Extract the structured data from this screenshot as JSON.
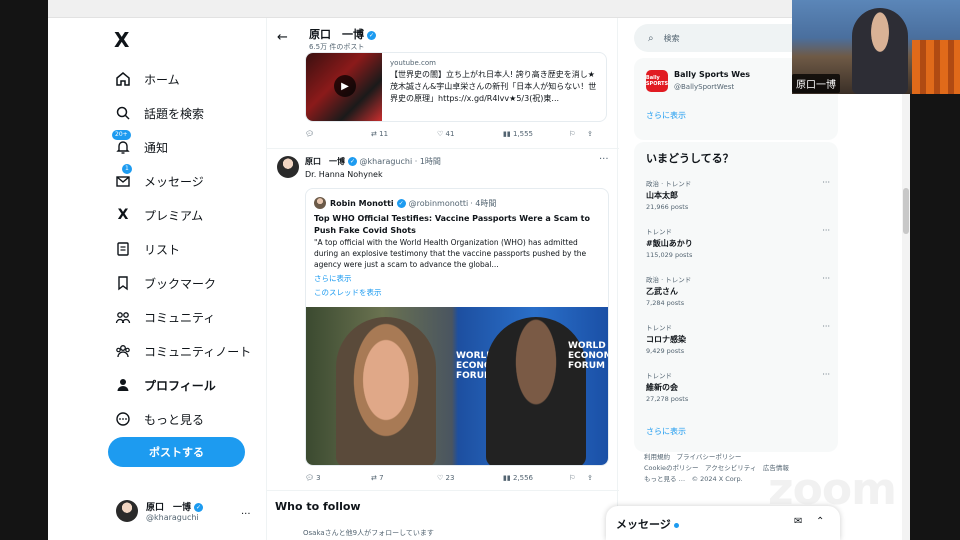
{
  "sidebar": {
    "logo": "X",
    "items": [
      {
        "label": "ホーム",
        "icon": "home-icon"
      },
      {
        "label": "話題を検索",
        "icon": "search-icon"
      },
      {
        "label": "通知",
        "icon": "bell-icon",
        "badge": "20+"
      },
      {
        "label": "メッセージ",
        "icon": "mail-icon",
        "badge": "1"
      },
      {
        "label": "プレミアム",
        "icon": "x-premium-icon"
      },
      {
        "label": "リスト",
        "icon": "list-icon"
      },
      {
        "label": "ブックマーク",
        "icon": "bookmark-icon"
      },
      {
        "label": "コミュニティ",
        "icon": "community-icon"
      },
      {
        "label": "コミュニティノート",
        "icon": "community-notes-icon"
      },
      {
        "label": "プロフィール",
        "icon": "profile-icon"
      },
      {
        "label": "もっと見る",
        "icon": "more-circle-icon"
      }
    ],
    "post_button": "ポストする",
    "account": {
      "name": "原口　一博",
      "handle": "@kharaguchi",
      "more": "..."
    }
  },
  "header": {
    "back": "←",
    "name": "原口　一博",
    "count": "6.5万 件のポスト"
  },
  "link_card": {
    "domain": "youtube.com",
    "title": "【世界史の闇】立ち上がれ日本人! 誇り高き歴史を消し★茂木誠さん&宇山卓栄さんの新刊「日本人が知らない！世界史の原理」https://x.gd/R4lvv★5/3(祝)東..."
  },
  "first_actions": {
    "replies": "",
    "retweets": "11",
    "likes": "41",
    "views": "1,555"
  },
  "tweet": {
    "name": "原口　一博",
    "handle": "@kharaguchi",
    "time": "· 1時間",
    "text": "Dr. Hanna Nohynek",
    "quote": {
      "name": "Robin Monotti",
      "handle": "@robinmonotti",
      "time": "· 4時間",
      "title": "Top WHO Official Testifies: Vaccine Passports Were a Scam to Push Fake Covid Shots",
      "body": "\"A top official with the World Health Organization (WHO) has admitted during an explosive testimony that the vaccine passports pushed by the agency were just a scam to advance the global...",
      "show_more": "さらに表示",
      "show_thread": "このスレッドを表示",
      "image_text": [
        "WORLD",
        "ECONOMIC",
        "FORUM"
      ]
    },
    "actions": {
      "replies": "3",
      "retweets": "7",
      "likes": "23",
      "views": "2,556"
    }
  },
  "who_to_follow": {
    "title": "Who to follow",
    "subtitle": "Osakaさんと他9人がフォローしています"
  },
  "search": {
    "placeholder": "検索"
  },
  "bally": {
    "logo_text": "Bally SPORTS",
    "name": "Bally Sports Wes",
    "handle": "@BallySportWest",
    "more": "さらに表示"
  },
  "trends": {
    "title": "いまどうしてる？",
    "items": [
      {
        "category": "政治 · トレンド",
        "name": "山本太郎",
        "count": "21,966 posts"
      },
      {
        "category": "トレンド",
        "name": "#飯山あかり",
        "count": "115,029 posts"
      },
      {
        "category": "政治 · トレンド",
        "name": "乙武さん",
        "count": "7,284 posts"
      },
      {
        "category": "トレンド",
        "name": "コロナ感染",
        "count": "9,429 posts"
      },
      {
        "category": "トレンド",
        "name": "維新の会",
        "count": "27,278 posts"
      }
    ],
    "more": "さらに表示"
  },
  "footer": {
    "lines": [
      "利用規約　プライバシーポリシー",
      "Cookieのポリシー　アクセシビリティ　広告情報",
      "もっと見る …　© 2024 X Corp."
    ]
  },
  "messages": {
    "title": "メッセージ"
  },
  "overlay": {
    "video_name": "原口一博",
    "watermark": "zoom"
  },
  "colors": {
    "accent": "#1d9bf0",
    "text": "#0f1419",
    "muted": "#536471"
  }
}
